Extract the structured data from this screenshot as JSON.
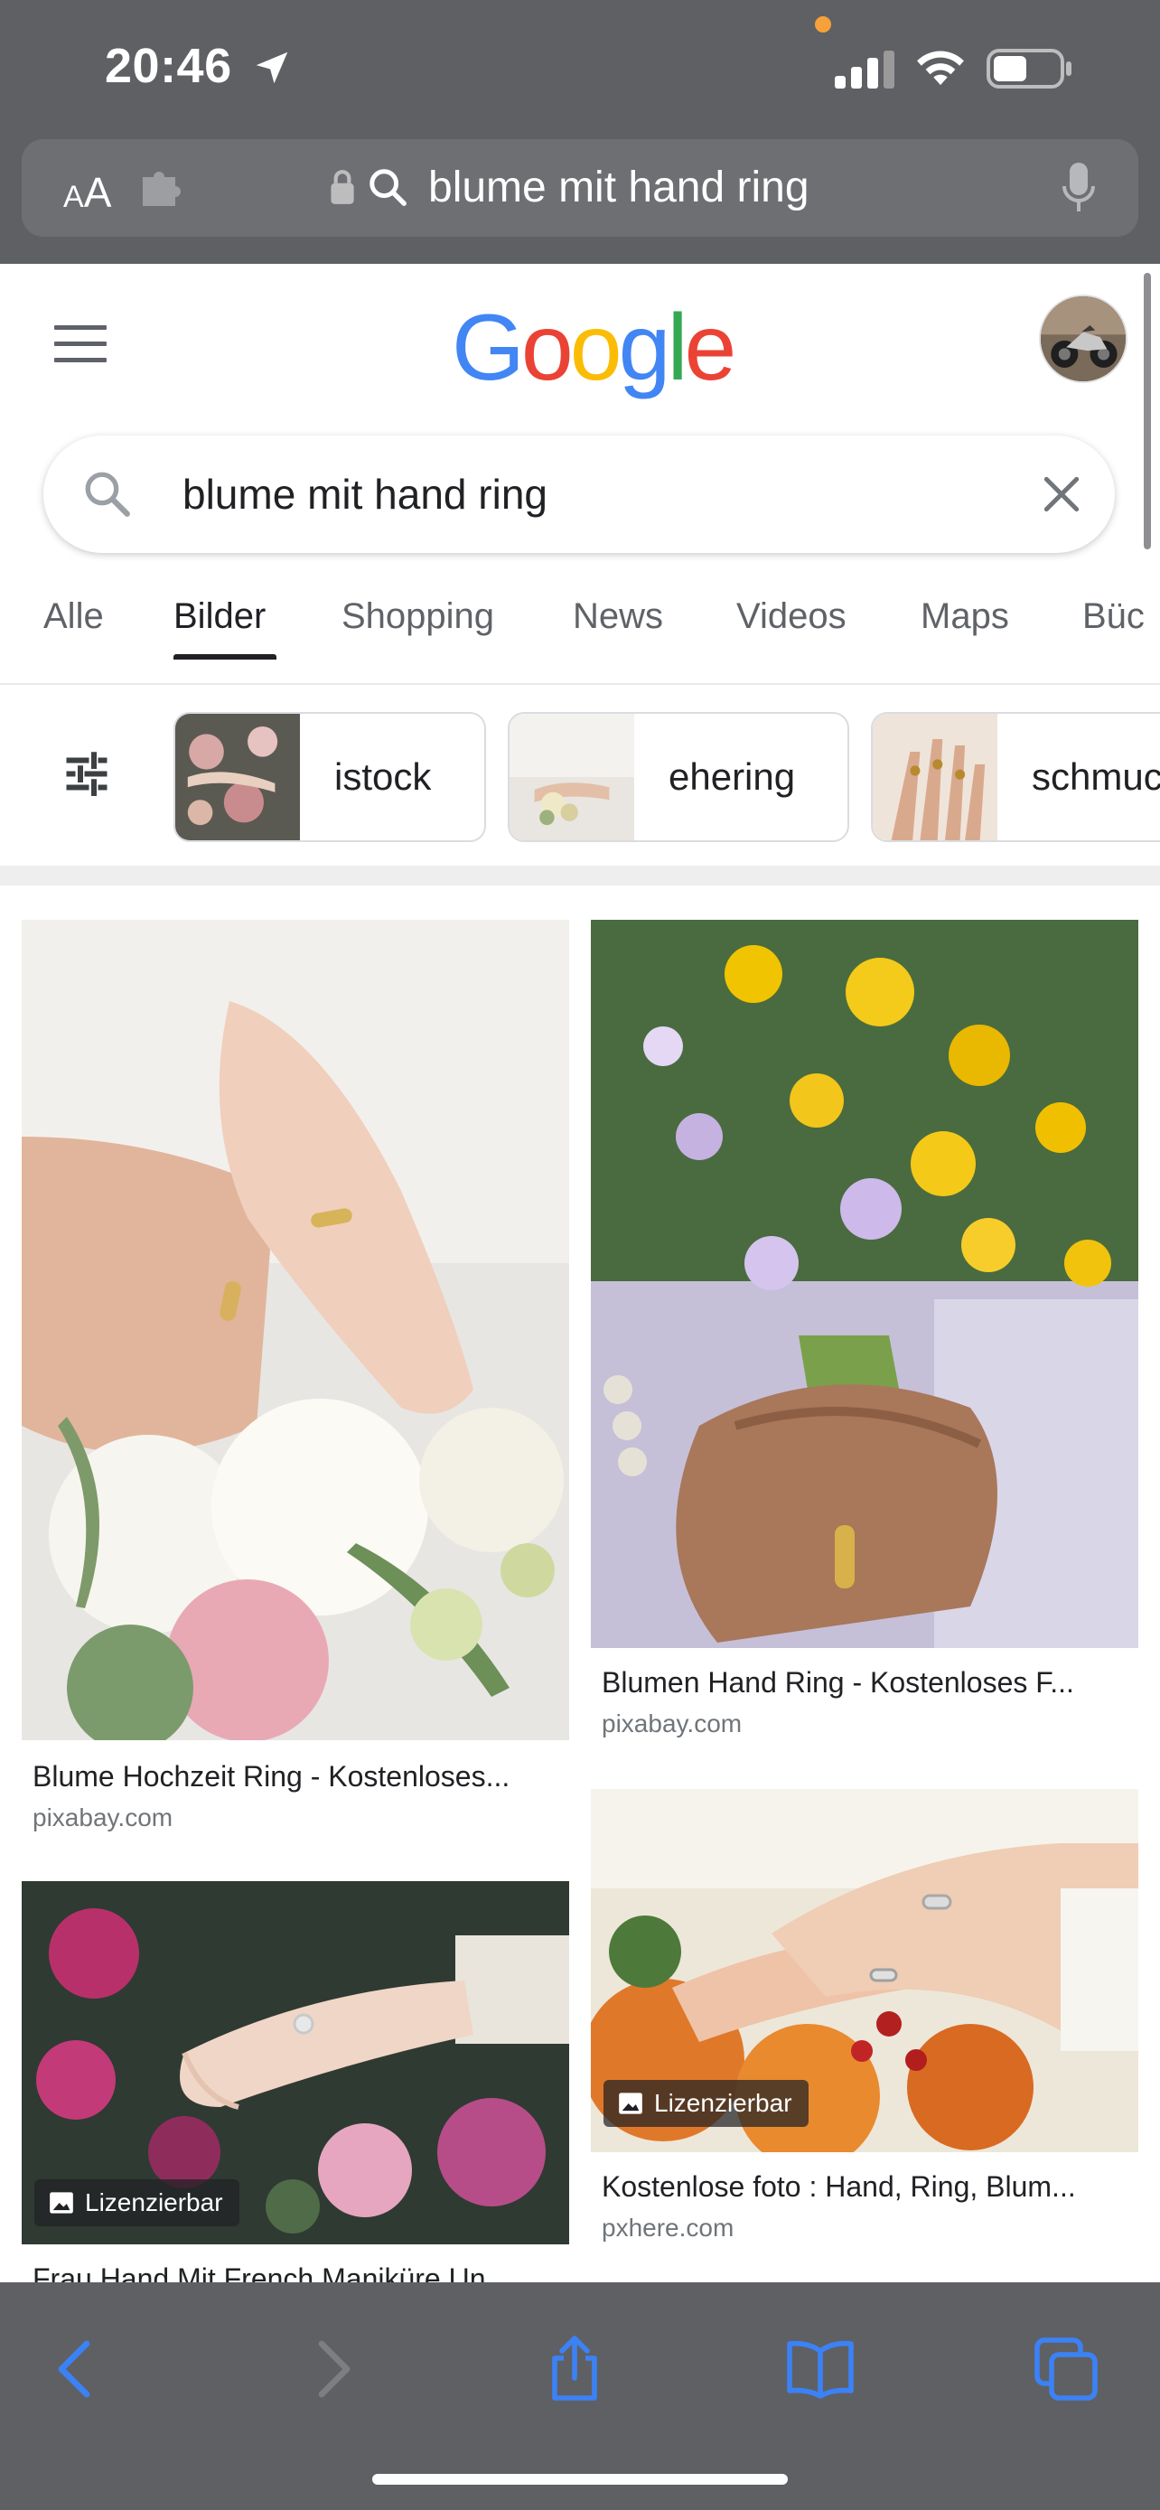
{
  "status_bar": {
    "time": "20:46"
  },
  "safari": {
    "aa_small": "A",
    "aa_big": "A",
    "url_text": "blume mit hand ring"
  },
  "google": {
    "logo": {
      "g1": "G",
      "o1": "o",
      "o2": "o",
      "g2": "g",
      "l": "l",
      "e": "e"
    },
    "search_query": "blume mit hand ring"
  },
  "tabs": [
    {
      "label": "Alle",
      "active": false
    },
    {
      "label": "Bilder",
      "active": true
    },
    {
      "label": "Shopping",
      "active": false
    },
    {
      "label": "News",
      "active": false
    },
    {
      "label": "Videos",
      "active": false
    },
    {
      "label": "Maps",
      "active": false
    },
    {
      "label": "Büc",
      "active": false
    }
  ],
  "chips": [
    {
      "label": "istock"
    },
    {
      "label": "ehering"
    },
    {
      "label": "schmuc"
    }
  ],
  "results": [
    {
      "title": "Blume Hochzeit Ring - Kostenloses...",
      "source": "pixabay.com",
      "badge": ""
    },
    {
      "title": "Blumen Hand Ring - Kostenloses F...",
      "source": "pixabay.com",
      "badge": ""
    },
    {
      "title": "Frau Hand Mit French Maniküre Un...",
      "source": "",
      "badge": "Lizenzierbar"
    },
    {
      "title": "Kostenlose foto : Hand, Ring, Blum...",
      "source": "pxhere.com",
      "badge": "Lizenzierbar"
    }
  ],
  "icons": {
    "status": [
      "location-arrow-icon",
      "signal-icon",
      "wifi-icon",
      "battery-icon"
    ],
    "url_bar": [
      "extension-icon",
      "lock-icon",
      "search-icon",
      "microphone-icon"
    ],
    "bottom_toolbar": [
      "back-icon",
      "forward-icon",
      "share-icon",
      "bookmarks-icon",
      "tabs-icon"
    ]
  },
  "colors": {
    "safari_chrome": "#5f6064",
    "google_blue": "#4285f4",
    "google_red": "#ea4335",
    "google_yellow": "#fbbc05",
    "google_green": "#34a853",
    "toolbar_icon": "#3b82f6"
  }
}
